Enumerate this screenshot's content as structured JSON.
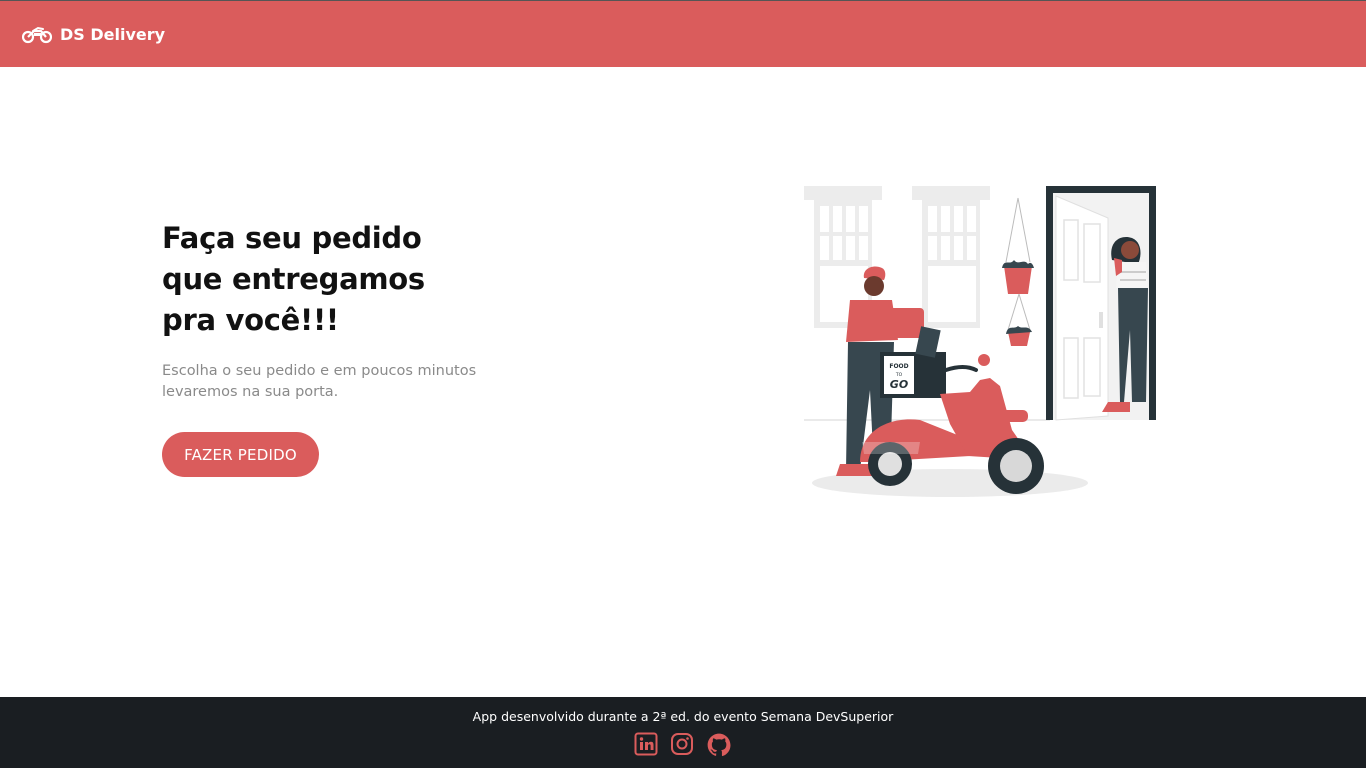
{
  "navbar": {
    "brand": "DS Delivery",
    "logo_icon": "motorcycle-icon",
    "background_color": "#DA5C5C"
  },
  "hero": {
    "title_lines": [
      "Faça seu pedido",
      "que entregamos",
      "pra você!!!"
    ],
    "subtitle_lines": [
      "Escolha o seu pedido e em poucos minutos",
      "levaremos na sua porta."
    ],
    "cta_label": "FAZER PEDIDO",
    "accent_color": "#DA5C5C"
  },
  "illustration": {
    "box_line1": "FOOD",
    "box_line2": "TO",
    "box_line3": "GO"
  },
  "footer": {
    "text": "App desenvolvido durante a 2ª ed. do evento Semana DevSuperior",
    "social_icons": [
      "linkedin-icon",
      "instagram-icon",
      "github-icon"
    ],
    "background_color": "#1A1E22"
  }
}
